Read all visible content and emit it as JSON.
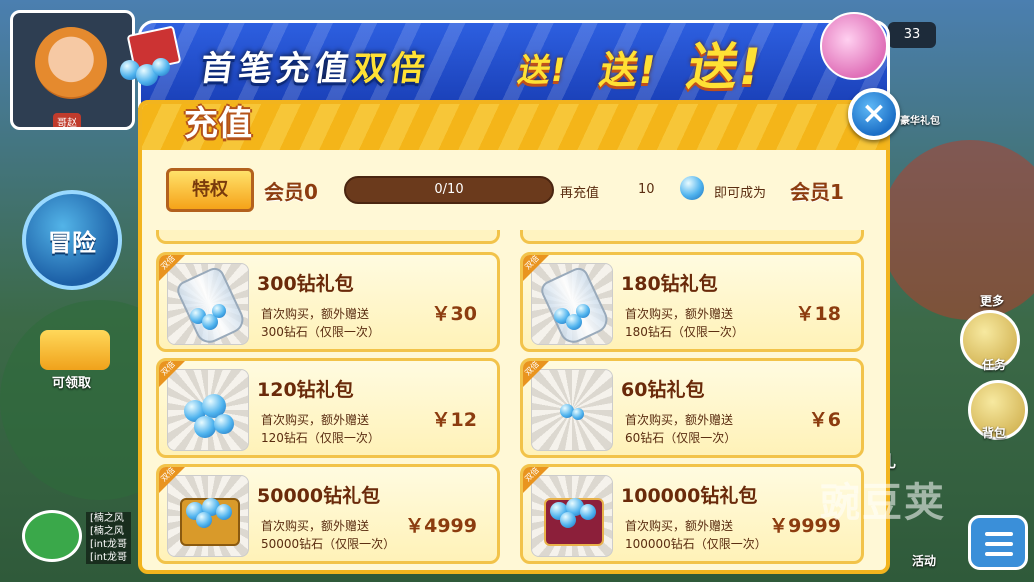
{
  "hud": {
    "player_name": "哥赵",
    "adventure_label": "冒险",
    "claim_label": "可领取",
    "chat_log": [
      "[楠之风",
      "[楠之风",
      "[int龙哥",
      "[int龙哥"
    ],
    "count": "33",
    "right_more": "更多",
    "right_task": "任务",
    "right_bag": "背包",
    "right_record": "录礼",
    "right_activity": "活动",
    "right_gift": "豪华礼包"
  },
  "banner": {
    "text_white": "首笔充值",
    "text_yellow": "双倍",
    "send1": "送!",
    "send2": "送!",
    "send3": "送!"
  },
  "panel": {
    "title": "充值",
    "close_icon": "close-icon",
    "privilege_button": "特权",
    "vip_current": "会员0",
    "progress_text": "0/10",
    "progress_fraction": 0.0,
    "recharge_prefix": "再充值",
    "recharge_amount": "10",
    "become_text": "即可成为",
    "vip_next": "会员1"
  },
  "packs": [
    {
      "tag": "双倍",
      "title": "300钻礼包",
      "desc1": "首次购买，额外赠送",
      "desc2": "300钻石（仅限一次）",
      "price": "￥30",
      "art": "bottle"
    },
    {
      "tag": "双倍",
      "title": "180钻礼包",
      "desc1": "首次购买，额外赠送",
      "desc2": "180钻石（仅限一次）",
      "price": "￥18",
      "art": "bottle"
    },
    {
      "tag": "双倍",
      "title": "120钻礼包",
      "desc1": "首次购买，额外赠送",
      "desc2": "120钻石（仅限一次）",
      "price": "￥12",
      "art": "pile"
    },
    {
      "tag": "双倍",
      "title": "60钻礼包",
      "desc1": "首次购买，额外赠送",
      "desc2": "60钻石（仅限一次）",
      "price": "￥6",
      "art": "few"
    },
    {
      "tag": "双倍",
      "title": "50000钻礼包",
      "desc1": "首次购买，额外赠送",
      "desc2": "50000钻石（仅限一次）",
      "price": "￥4999",
      "art": "chest-gold"
    },
    {
      "tag": "双倍",
      "title": "100000钻礼包",
      "desc1": "首次购买，额外赠送",
      "desc2": "100000钻石（仅限一次）",
      "price": "￥9999",
      "art": "chest-red"
    }
  ],
  "watermark": "豌豆荚",
  "colors": {
    "accent": "#f2b41e",
    "banner_blue": "#1a40b8",
    "price_brown": "#8c3c0f"
  }
}
